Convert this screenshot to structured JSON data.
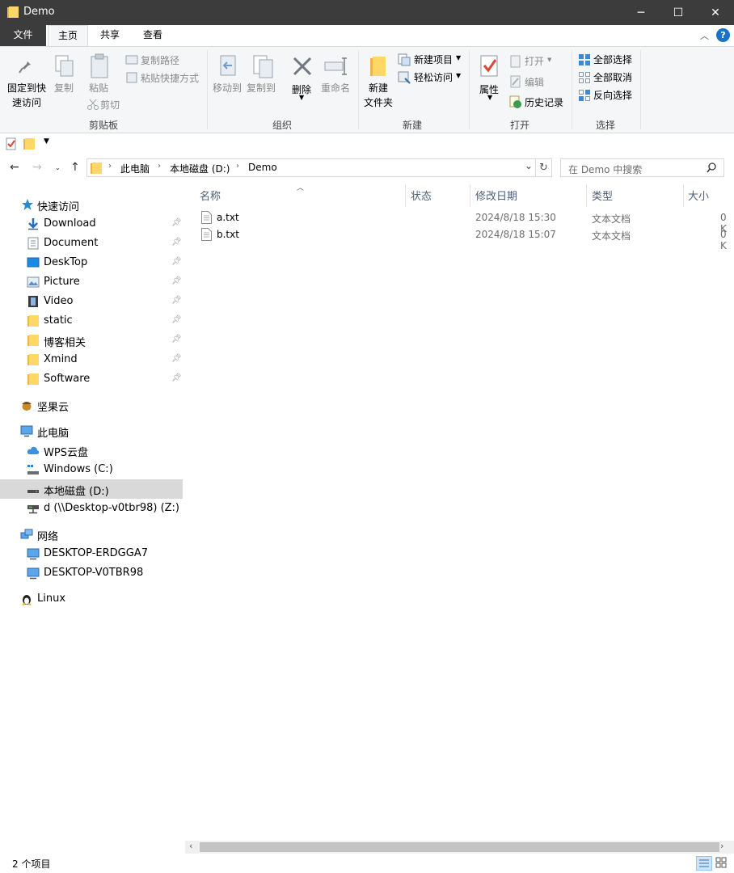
{
  "window": {
    "title": "Demo",
    "minimize": "─",
    "maximize": "☐",
    "close": "✕"
  },
  "ribbon_tabs": {
    "file": "文件",
    "home": "主页",
    "share": "共享",
    "view": "查看",
    "collapse": "︿",
    "help": "?"
  },
  "ribbon": {
    "clipboard": {
      "pin_line1": "固定到快",
      "pin_line2": "速访问",
      "copy": "复制",
      "paste": "粘贴",
      "copy_path": "复制路径",
      "paste_shortcut": "粘贴快捷方式",
      "cut": "剪切",
      "label": "剪贴板"
    },
    "organize": {
      "move_to": "移动到",
      "copy_to": "复制到",
      "delete": "删除",
      "rename": "重命名",
      "label": "组织"
    },
    "new": {
      "new_folder_line1": "新建",
      "new_folder_line2": "文件夹",
      "new_item": "新建项目",
      "easy_access": "轻松访问",
      "label": "新建"
    },
    "open": {
      "properties": "属性",
      "open": "打开",
      "edit": "编辑",
      "history": "历史记录",
      "label": "打开"
    },
    "select": {
      "select_all": "全部选择",
      "select_none": "全部取消",
      "invert": "反向选择",
      "label": "选择"
    }
  },
  "address": {
    "crumbs": [
      "此电脑",
      "本地磁盘 (D:)",
      "Demo"
    ],
    "separator": "›",
    "search_placeholder": "在 Demo 中搜索"
  },
  "nav": {
    "quick_access": "快速访问",
    "quick_items": [
      "Download",
      "Document",
      "DeskTop",
      "Picture",
      "Video",
      "static",
      "博客相关",
      "Xmind",
      "Software"
    ],
    "jianguoyun": "坚果云",
    "this_pc": "此电脑",
    "pc_items": [
      "WPS云盘",
      "Windows (C:)",
      "本地磁盘 (D:)",
      "d (\\\\Desktop-v0tbr98) (Z:)"
    ],
    "network": "网络",
    "network_items": [
      "DESKTOP-ERDGGA7",
      "DESKTOP-V0TBR98"
    ],
    "linux": "Linux",
    "selected": "本地磁盘 (D:)"
  },
  "columns": {
    "name": "名称",
    "status": "状态",
    "modified": "修改日期",
    "type": "类型",
    "size": "大小"
  },
  "files": [
    {
      "name": "a.txt",
      "modified": "2024/8/18 15:30",
      "type": "文本文档",
      "size": "0 K"
    },
    {
      "name": "b.txt",
      "modified": "2024/8/18 15:07",
      "type": "文本文档",
      "size": "0 K"
    }
  ],
  "status": {
    "item_count": "2 个项目"
  },
  "colors": {
    "titlebar": "#3c3c3c",
    "ribbon_bg": "#f5f6f7",
    "selected_nav": "#d9d9d9",
    "accent_blue": "#1a73c8",
    "folder_yellow": "#ffd766"
  }
}
